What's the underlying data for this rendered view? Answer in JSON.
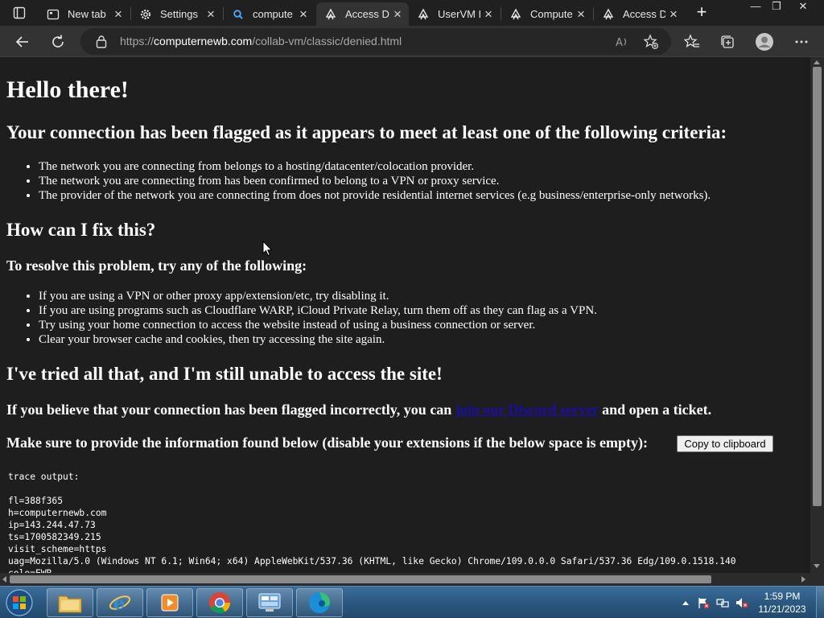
{
  "browser": {
    "tabs": [
      {
        "title": "New tab",
        "icon": "newtab-icon",
        "active": false
      },
      {
        "title": "Settings",
        "icon": "gear-icon",
        "active": false
      },
      {
        "title": "compute",
        "icon": "search-icon",
        "active": false
      },
      {
        "title": "Access D",
        "icon": "cloudflare-icon",
        "active": true
      },
      {
        "title": "UserVM I",
        "icon": "cloudflare-icon",
        "active": false
      },
      {
        "title": "Compute",
        "icon": "cloudflare-icon",
        "active": false
      },
      {
        "title": "Access D",
        "icon": "cloudflare-icon",
        "active": false
      }
    ],
    "new_tab_symbol": "+",
    "window_controls": {
      "minimize": "—",
      "restore": "❐",
      "close": "✕"
    },
    "address": {
      "scheme": "https://",
      "domain": "computernewb.com",
      "path": "/collab-vm/classic/denied.html"
    }
  },
  "page": {
    "heading": "Hello there!",
    "criteria_heading": "Your connection has been flagged as it appears to meet at least one of the following criteria:",
    "criteria": [
      "The network you are connecting from belongs to a hosting/datacenter/colocation provider.",
      "The network you are connecting from has been confirmed to belong to a VPN or proxy service.",
      "The provider of the network you are connecting from does not provide residential internet services (e.g business/enterprise-only networks)."
    ],
    "fix_heading": "How can I fix this?",
    "resolve_heading": "To resolve this problem, try any of the following:",
    "fixes": [
      "If you are using a VPN or other proxy app/extension/etc, try disabling it.",
      "If you are using programs such as Cloudflare WARP, iCloud Private Relay, turn them off as they can flag as a VPN.",
      "Try using your home connection to access the website instead of using a business connection or server.",
      "Clear your browser cache and cookies, then try accessing the site again."
    ],
    "tried_heading": "I've tried all that, and I'm still unable to access the site!",
    "discord_before": "If you believe that your connection has been flagged incorrectly, you can ",
    "discord_link": "join our Discord server",
    "discord_after": " and open a ticket.",
    "info_heading": "Make sure to provide the information found below (disable your extensions if the below space is empty):",
    "copy_button": "Copy to clipboard",
    "trace": "trace output:\n\nfl=388f365\nh=computernewb.com\nip=143.244.47.73\nts=1700582349.215\nvisit_scheme=https\nuag=Mozilla/5.0 (Windows NT 6.1; Win64; x64) AppleWebKit/537.36 (KHTML, like Gecko) Chrome/109.0.0.0 Safari/537.36 Edg/109.0.1518.140\ncolo=EWR"
  },
  "taskbar": {
    "apps": [
      "explorer-icon",
      "internet-explorer-icon",
      "media-player-icon",
      "chrome-icon",
      "control-panel-icon",
      "edge-icon"
    ],
    "clock_time": "1:59 PM",
    "clock_date": "11/21/2023"
  },
  "colors": {
    "page_bg": "#1e1e1e",
    "link": "#1a0dab",
    "taskbar": "#2c5a82"
  }
}
